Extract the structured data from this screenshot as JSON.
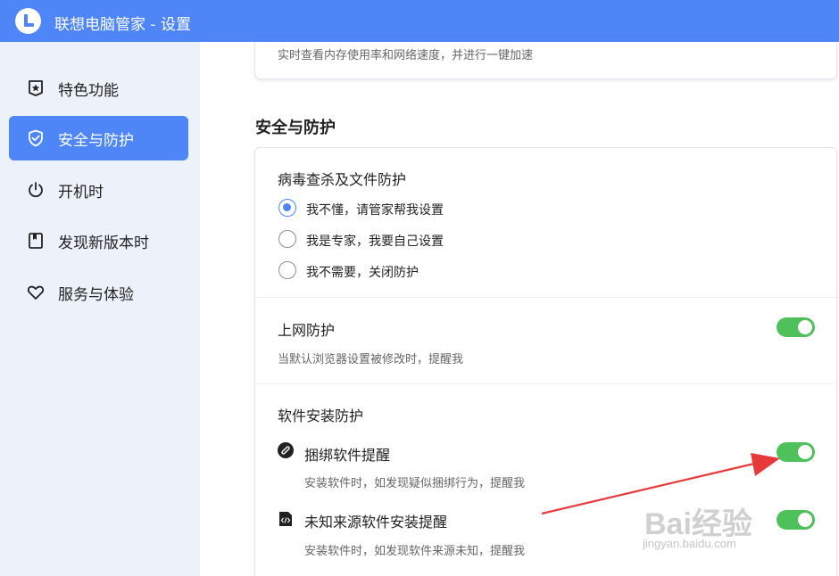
{
  "window": {
    "title": "联想电脑管家 - 设置"
  },
  "sidebar": {
    "items": [
      {
        "label": "特色功能",
        "icon": "star-badge-icon",
        "active": false
      },
      {
        "label": "安全与防护",
        "icon": "shield-check-icon",
        "active": true
      },
      {
        "label": "开机时",
        "icon": "power-icon",
        "active": false
      },
      {
        "label": "发现新版本时",
        "icon": "bookmark-icon",
        "active": false
      },
      {
        "label": "服务与体验",
        "icon": "heart-icon",
        "active": false
      }
    ]
  },
  "prev_card": {
    "desc": "实时查看内存使用率和网络速度，并进行一键加速"
  },
  "section": {
    "title": "安全与防护"
  },
  "virus": {
    "title": "病毒查杀及文件防护",
    "options": [
      {
        "label": "我不懂，请管家帮我设置",
        "checked": true
      },
      {
        "label": "我是专家，我要自己设置",
        "checked": false
      },
      {
        "label": "我不需要，关闭防护",
        "checked": false
      }
    ]
  },
  "web": {
    "title": "上网防护",
    "desc": "当默认浏览器设置被修改时，提醒我",
    "enabled": true
  },
  "install": {
    "title": "软件安装防护",
    "items": [
      {
        "label": "捆绑软件提醒",
        "desc": "安装软件时，如发现疑似捆绑行为，提醒我",
        "icon": "link-badge-icon",
        "enabled": true
      },
      {
        "label": "未知来源软件安装提醒",
        "desc": "安装软件时，如发现软件来源未知，提醒我",
        "icon": "code-file-icon",
        "enabled": true
      }
    ]
  },
  "watermark": {
    "text": "Bai经验",
    "url": "jingyan.baidu.com"
  },
  "colors": {
    "accent": "#4f86f7",
    "toggle_on": "#4ec15b",
    "annotation_arrow": "#e8393a"
  }
}
